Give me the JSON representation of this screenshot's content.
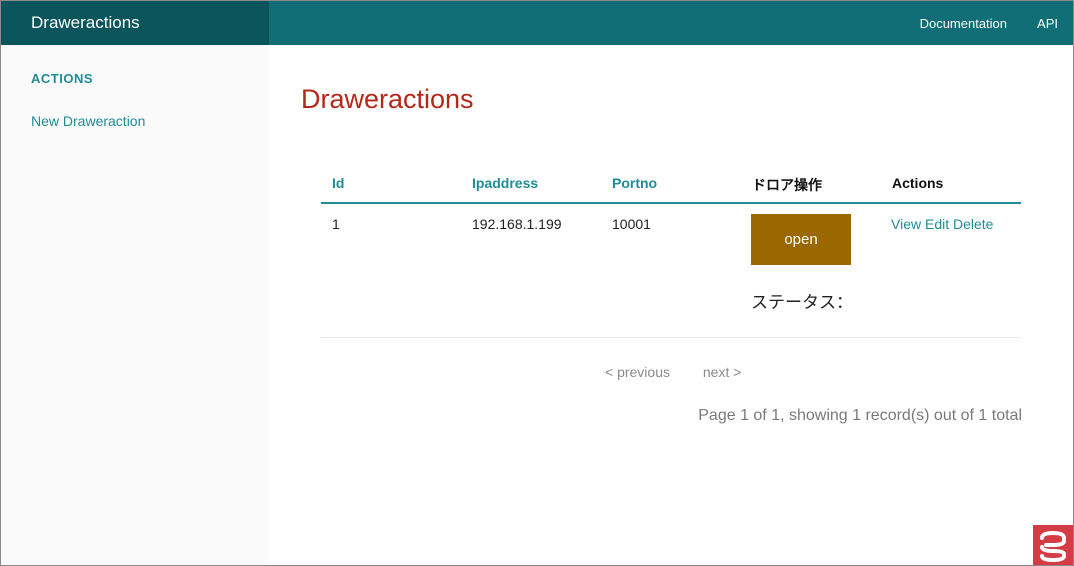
{
  "app": {
    "title": "Draweractions"
  },
  "topnav": {
    "items": [
      {
        "label": "Documentation"
      },
      {
        "label": "API"
      }
    ]
  },
  "sidebar": {
    "heading": "ACTIONS",
    "items": [
      {
        "label": "New Draweraction"
      }
    ]
  },
  "main": {
    "title": "Draweractions",
    "table": {
      "headers": [
        {
          "label": "Id"
        },
        {
          "label": "Ipaddress"
        },
        {
          "label": "Portno"
        },
        {
          "label": "ドロア操作"
        },
        {
          "label": "Actions"
        }
      ],
      "rows": [
        {
          "id": "1",
          "ipaddress": "192.168.1.199",
          "portno": "10001",
          "drawer_button_label": "open",
          "status_label": "ステータス：",
          "actions": {
            "view": "View",
            "edit": "Edit",
            "delete": "Delete"
          }
        }
      ]
    },
    "pagination": {
      "previous": "< previous",
      "next": "next >",
      "summary": "Page 1 of 1, showing 1 record(s) out of 1 total"
    }
  },
  "colors": {
    "topbar": "#116d76",
    "brand_bg": "#0a545b",
    "accent": "#1f8c97",
    "title_red": "#b52718",
    "open_button": "#9b6700",
    "logo_red": "#d33c44"
  },
  "icons": {
    "corner_logo": "cakephp-logo-icon"
  }
}
